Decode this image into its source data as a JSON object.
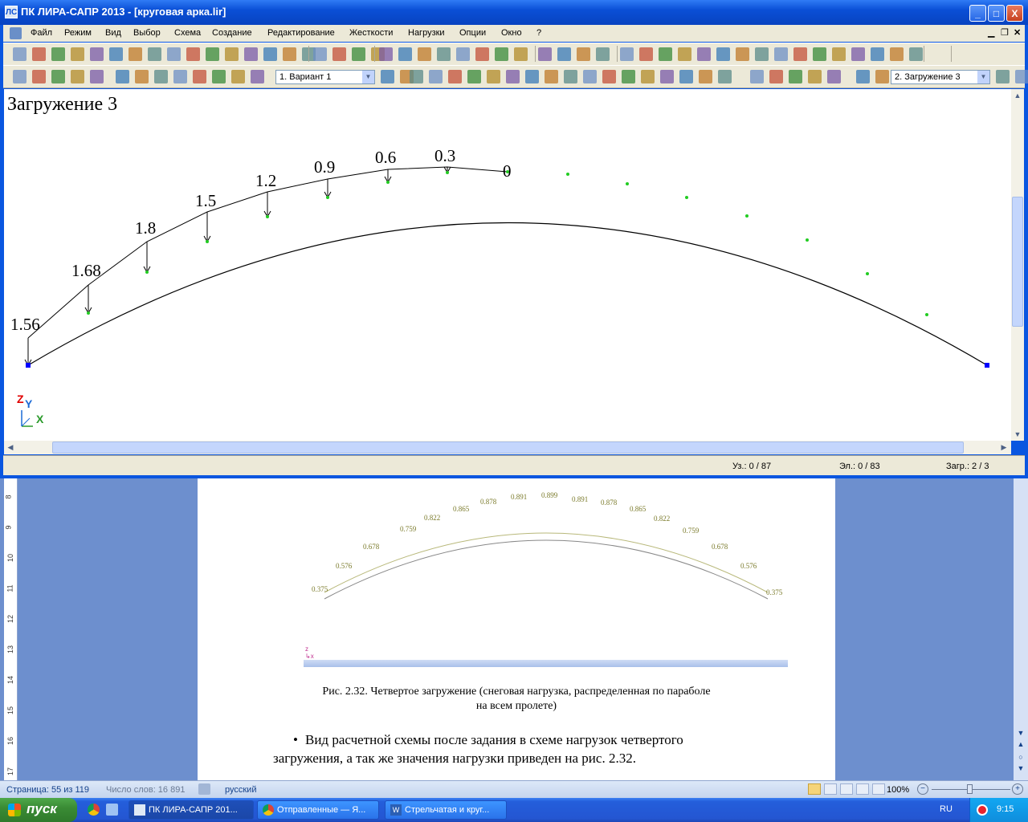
{
  "window": {
    "title": "ПК ЛИРА-САПР  2013 - [круговая арка.lir]",
    "minimize": "_",
    "maximize": "□",
    "close": "X"
  },
  "menu": [
    "Файл",
    "Режим",
    "Вид",
    "Выбор",
    "Схема",
    "Создание",
    "Редактирование",
    "Жесткости",
    "Нагрузки",
    "Опции",
    "Окно",
    "?"
  ],
  "toolbar": {
    "variant_select": "1. Вариант 1",
    "load_case_select": "2. Загружение 3"
  },
  "canvas": {
    "heading": "Загружение 3",
    "load_labels": [
      "1.56",
      "1.68",
      "1.8",
      "1.5",
      "1.2",
      "0.9",
      "0.6",
      "0.3",
      "0"
    ],
    "axis_z": "Z",
    "axis_y": "Y",
    "axis_x": "X"
  },
  "status": {
    "nodes": "Уз.: 0 / 87",
    "elements": "Эл.: 0 / 83",
    "load": "Загр.: 2 / 3"
  },
  "word": {
    "ruler_numbers": [
      "8",
      "9",
      "10",
      "11",
      "12",
      "13",
      "14",
      "15",
      "16",
      "17"
    ],
    "figure_labels": [
      "0.375",
      "0.576",
      "0.678",
      "0.759",
      "0.822",
      "0.865",
      "0.878",
      "0.891",
      "0.899",
      "0.891",
      "0.878",
      "0.865",
      "0.822",
      "0.759",
      "0.678",
      "0.576",
      "0.375"
    ],
    "caption_line1": "Рис. 2.32. Четвертое загружение (снеговая нагрузка, распределенная по параболе",
    "caption_line2": "на всем пролете)",
    "bullet_line1": "Вид  расчетной  схемы  после  задания  в  схеме  нагрузок  четвертого",
    "bullet_line2": "загружения, а так же значения нагрузки приведен на рис. 2.32."
  },
  "word_status": {
    "page": "Страница: 55 из 119",
    "words": "Число слов: 16 891",
    "language": "русский",
    "zoom": "100%"
  },
  "taskbar": {
    "start": "пуск",
    "tasks": [
      "ПК ЛИРА-САПР  201...",
      "Отправленные — Я...",
      "Стрельчатая и круг..."
    ],
    "lang": "RU",
    "clock": "9:15"
  },
  "colors": {
    "title_blue": "#0a4fd6",
    "arch_node_green": "#22cc22",
    "support_blue": "#0000ff",
    "figure_olive": "#8b8b3a"
  }
}
